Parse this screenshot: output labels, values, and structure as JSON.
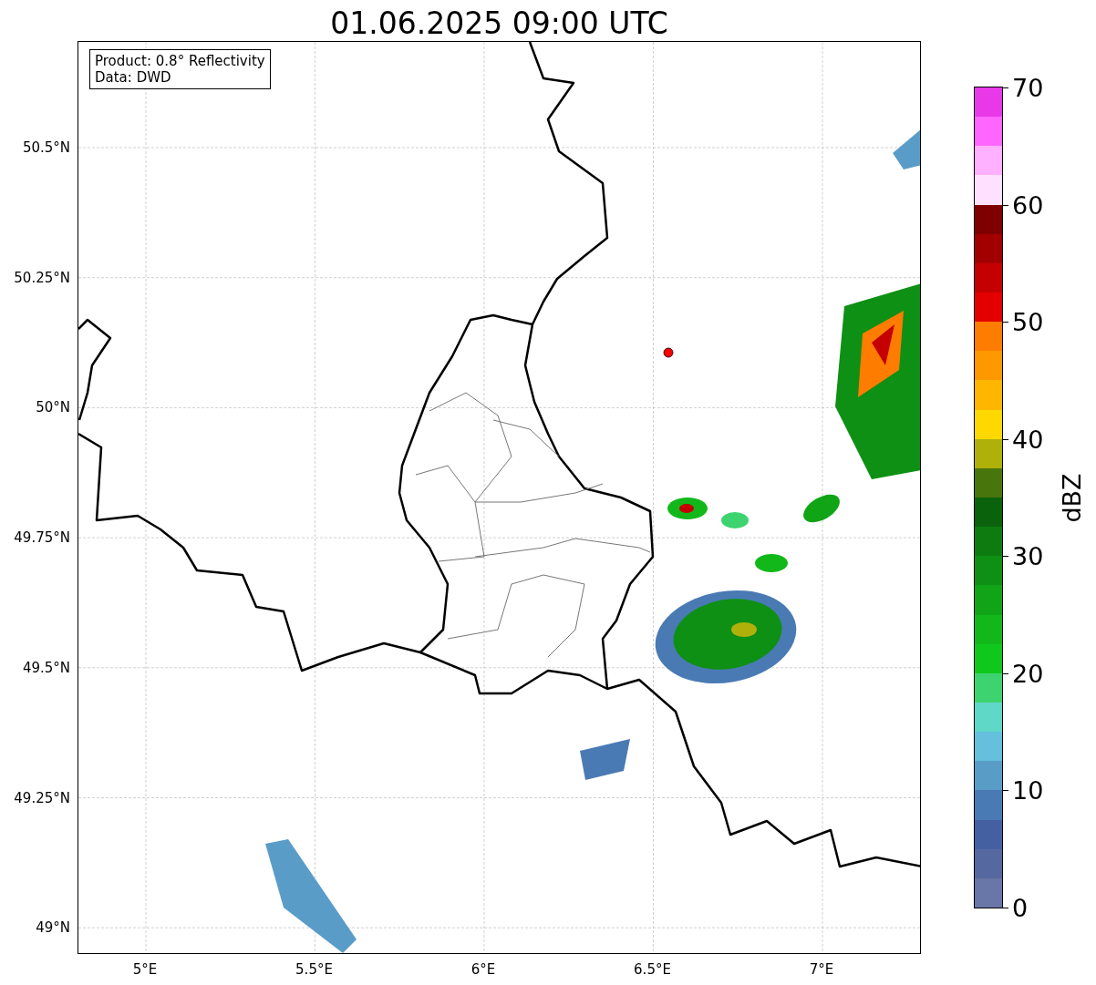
{
  "title": "01.06.2025 09:00 UTC",
  "legend": {
    "lines": [
      "Product: 0.8° Reflectivity",
      "Data: DWD"
    ]
  },
  "y_ticks": [
    "50.5°N",
    "50.25°N",
    "50°N",
    "49.75°N",
    "49.5°N",
    "49.25°N",
    "49°N"
  ],
  "x_ticks": [
    "5°E",
    "5.5°E",
    "6°E",
    "6.5°E",
    "7°E"
  ],
  "colorbar": {
    "label": "dBZ",
    "ticks": [
      "70",
      "60",
      "50",
      "40",
      "30",
      "20",
      "10",
      "0"
    ],
    "steps": [
      {
        "color": "#e838e8"
      },
      {
        "color": "#ff66ff"
      },
      {
        "color": "#ffb0ff"
      },
      {
        "color": "#ffe0ff"
      },
      {
        "color": "#7e0000"
      },
      {
        "color": "#a20000"
      },
      {
        "color": "#c40000"
      },
      {
        "color": "#e40000"
      },
      {
        "color": "#fe7c00"
      },
      {
        "color": "#fe9800"
      },
      {
        "color": "#feb600"
      },
      {
        "color": "#fed800"
      },
      {
        "color": "#b0b00a"
      },
      {
        "color": "#48760c"
      },
      {
        "color": "#0a620c"
      },
      {
        "color": "#0c7c10"
      },
      {
        "color": "#0e9014"
      },
      {
        "color": "#10a416"
      },
      {
        "color": "#12b81a"
      },
      {
        "color": "#10c81c"
      },
      {
        "color": "#3dd470"
      },
      {
        "color": "#60d8c8"
      },
      {
        "color": "#64c0dc"
      },
      {
        "color": "#5a9cc8"
      },
      {
        "color": "#4a7ab4"
      },
      {
        "color": "#4560a0"
      },
      {
        "color": "#5568a0"
      },
      {
        "color": "#6877a8"
      }
    ]
  }
}
